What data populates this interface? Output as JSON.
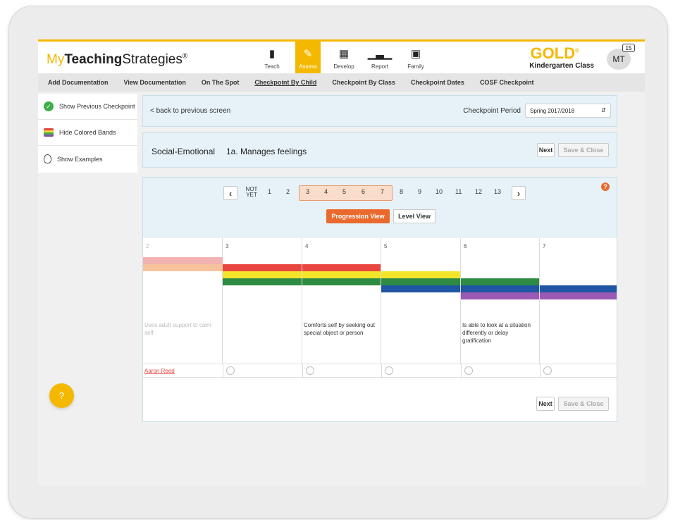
{
  "header": {
    "logo_my": "My",
    "logo_teaching": "Teaching",
    "logo_strategies": "Strategies",
    "logo_reg": "®",
    "nav": [
      {
        "label": "Teach",
        "icon": "teach-icon"
      },
      {
        "label": "Assess",
        "icon": "pencil-icon",
        "active": true
      },
      {
        "label": "Develop",
        "icon": "develop-icon"
      },
      {
        "label": "Report",
        "icon": "bar-chart-icon"
      },
      {
        "label": "Family",
        "icon": "family-icon"
      }
    ],
    "product": "GOLD",
    "product_reg": "®",
    "class_name": "Kindergarten Class",
    "avatar_initials": "MT",
    "notification_count": "15"
  },
  "subnav": [
    "Add Documentation",
    "View Documentation",
    "On The Spot",
    "Checkpoint By Child",
    "Checkpoint By Class",
    "Checkpoint Dates",
    "COSF Checkpoint"
  ],
  "sidebar": [
    {
      "label": "Show Previous Checkpoint",
      "icon": "check-circle-icon"
    },
    {
      "label": "Hide Colored Bands",
      "icon": "colored-bands-icon"
    },
    {
      "label": "Show Examples",
      "icon": "lightbulb-icon"
    }
  ],
  "checkpoint": {
    "back_link": "< back to previous screen",
    "period_label": "Checkpoint Period",
    "period_value": "Spring 2017/2018"
  },
  "objective": {
    "domain": "Social-Emotional",
    "name": "1a. Manages feelings",
    "next_label": "Next",
    "save_label": "Save & Close"
  },
  "progression": {
    "not_yet_line1": "NOT",
    "not_yet_line2": "YET",
    "levels": [
      "1",
      "2",
      "3",
      "4",
      "5",
      "6",
      "7",
      "8",
      "9",
      "10",
      "11",
      "12",
      "13"
    ],
    "highlighted_range": [
      "3",
      "7"
    ],
    "help_label": "?",
    "view_buttons": [
      "Progression View",
      "Level View"
    ]
  },
  "columns": [
    {
      "num": "2",
      "desc": "Uses adult support to calm self"
    },
    {
      "num": "3",
      "desc": ""
    },
    {
      "num": "4",
      "desc": "Comforts self by seeking out special object or person"
    },
    {
      "num": "5",
      "desc": ""
    },
    {
      "num": "6",
      "desc": "Is able to look at a situation differently or delay gratification"
    },
    {
      "num": "7",
      "desc": ""
    }
  ],
  "band_colors": {
    "pink": "#f3b3b1",
    "peach": "#f6c39e",
    "red": "#e8463e",
    "yellow": "#f4e52b",
    "green": "#2d8b43",
    "blue": "#1f56a3",
    "purple": "#9b59b6"
  },
  "child": {
    "name": "Aaron Reed"
  },
  "bottom_buttons": {
    "next": "Next",
    "save": "Save & Close"
  },
  "help_fab": "?"
}
